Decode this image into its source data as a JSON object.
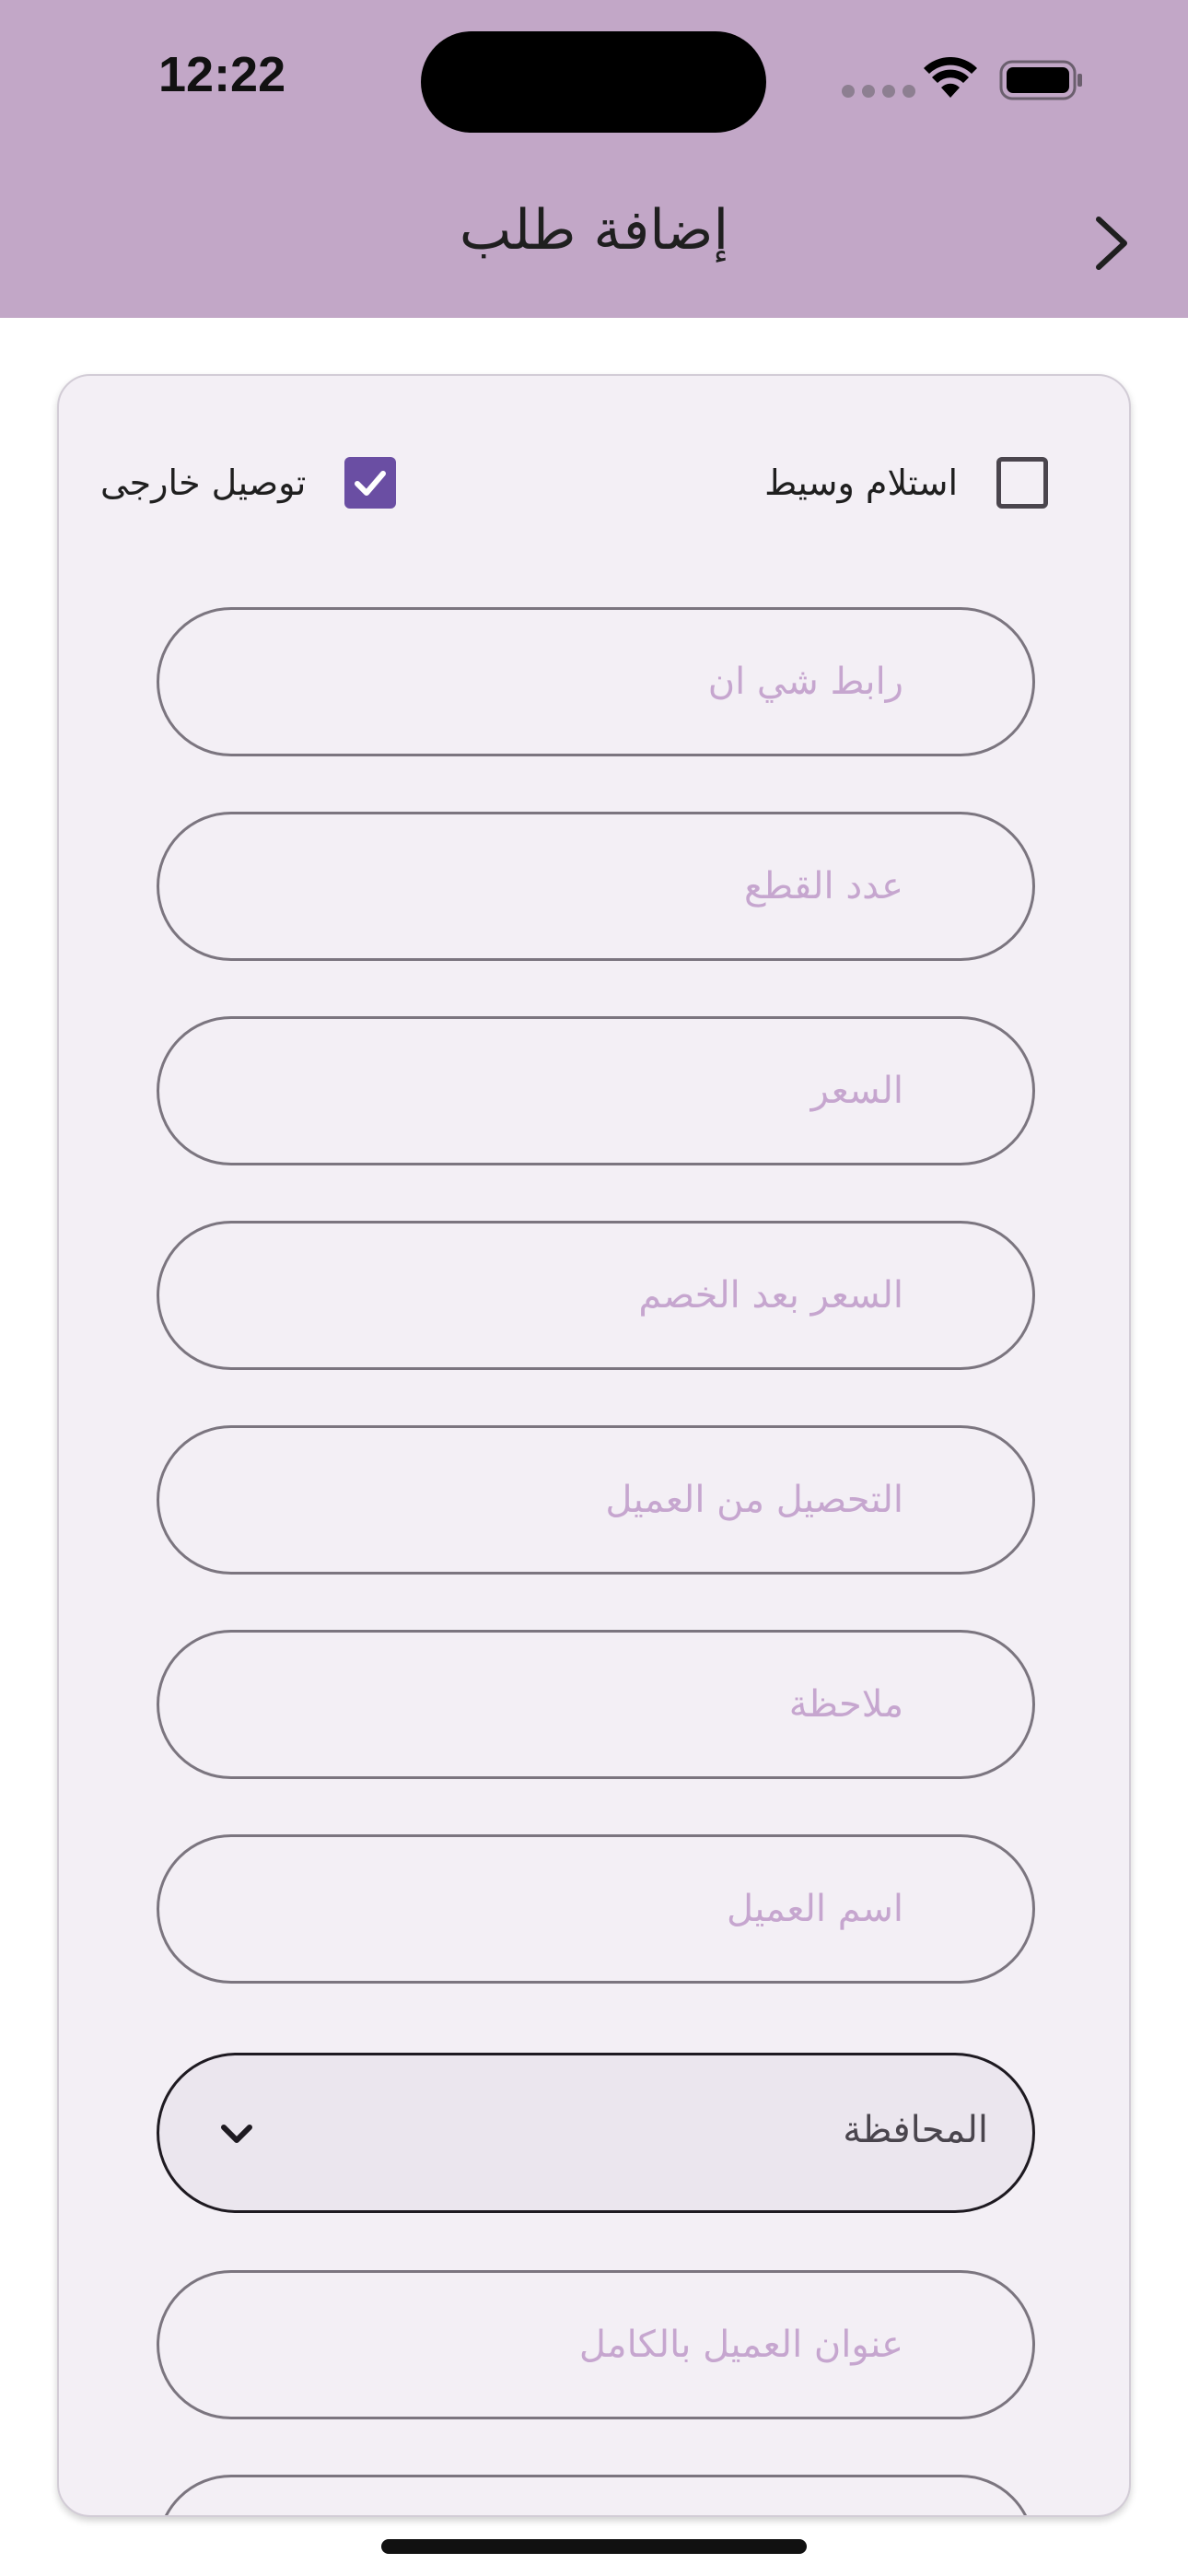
{
  "status_bar": {
    "time": "12:22"
  },
  "header": {
    "title": "إضافة طلب"
  },
  "checkboxes": {
    "external_delivery": {
      "label": "توصيل خارجى",
      "checked": true
    },
    "broker_pickup": {
      "label": "استلام وسيط",
      "checked": false
    }
  },
  "fields": {
    "shein_link": {
      "placeholder": "رابط شي ان"
    },
    "pieces_count": {
      "placeholder": "عدد القطع"
    },
    "price": {
      "placeholder": "السعر"
    },
    "price_after_discount": {
      "placeholder": "السعر بعد الخصم"
    },
    "collection_from_customer": {
      "placeholder": "التحصيل من العميل"
    },
    "note": {
      "placeholder": "ملاحظة"
    },
    "customer_name": {
      "placeholder": "اسم العميل"
    },
    "full_address": {
      "placeholder": "عنوان العميل بالكامل"
    }
  },
  "governorate_select": {
    "value": "المحافظة"
  },
  "colors": {
    "header": "#c2a7c7",
    "accent": "#6a4ea3",
    "placeholder": "#c6a6cf"
  }
}
